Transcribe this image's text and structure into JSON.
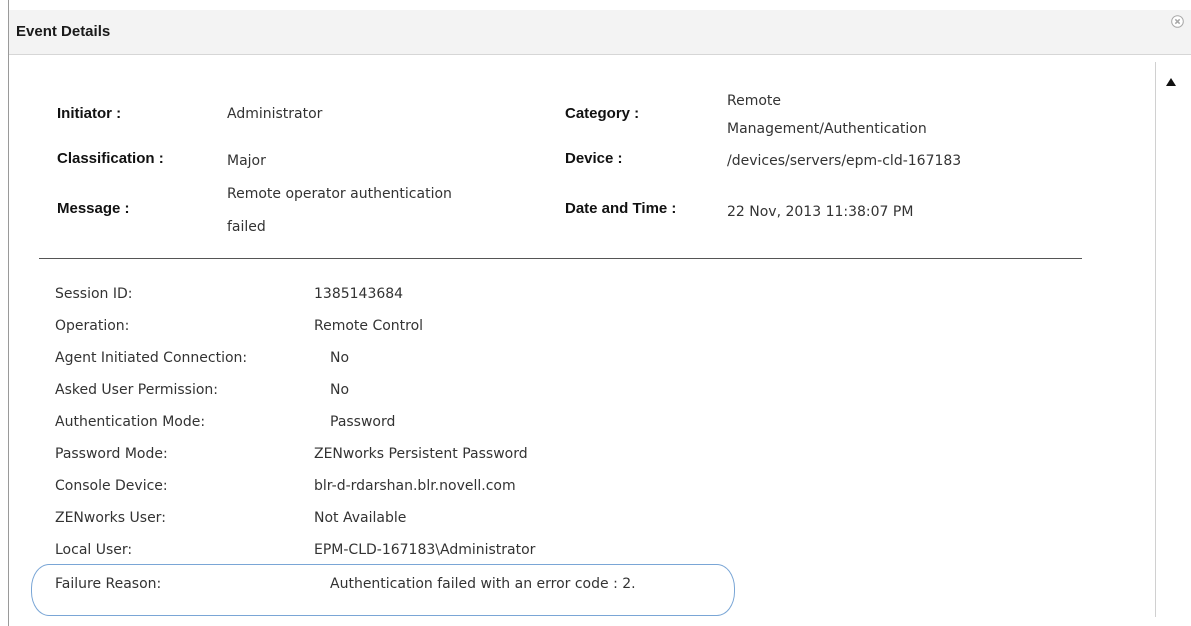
{
  "dialog": {
    "title": "Event Details",
    "close_icon": "close-circle-icon",
    "scroll_icon": "scroll-up-arrow-icon"
  },
  "summary": {
    "initiator_label": "Initiator :",
    "initiator_value": "Administrator",
    "classification_label": "Classification :",
    "classification_value": "Major",
    "message_label": "Message :",
    "message_value_line1": "Remote operator authentication",
    "message_value_line2": "failed",
    "category_label": "Category :",
    "category_value_line1": "Remote",
    "category_value_line2": "Management/Authentication",
    "device_label": "Device :",
    "device_value": "/devices/servers/epm-cld-167183",
    "datetime_label": "Date and Time :",
    "datetime_value": "22 Nov, 2013 11:38:07 PM"
  },
  "properties": [
    {
      "label": "Session ID:",
      "value": "1385143684"
    },
    {
      "label": "Operation:",
      "value": "Remote Control"
    },
    {
      "label": "Agent Initiated Connection:",
      "value": "No"
    },
    {
      "label": "Asked User Permission:",
      "value": "No"
    },
    {
      "label": "Authentication Mode:",
      "value": "Password"
    },
    {
      "label": "Password Mode:",
      "value": "ZENworks Persistent Password"
    },
    {
      "label": "Console Device:",
      "value": "blr-d-rdarshan.blr.novell.com"
    },
    {
      "label": "ZENworks User:",
      "value": "Not Available"
    },
    {
      "label": "Local User:",
      "value": "EPM-CLD-167183\\Administrator"
    },
    {
      "label": "Failure Reason:",
      "value": "Authentication failed with an error code : 2."
    }
  ],
  "colors": {
    "highlight": "#7aa6d6",
    "titlebar": "#f3f3f3"
  }
}
